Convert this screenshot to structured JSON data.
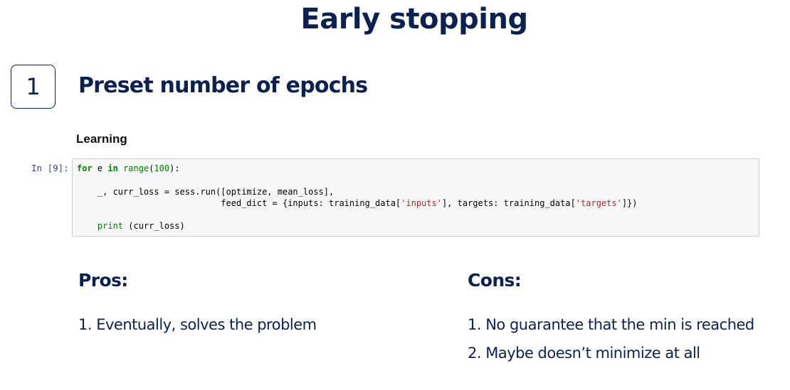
{
  "slide": {
    "title": "Early stopping"
  },
  "section": {
    "number": "1",
    "heading": "Preset number of epochs"
  },
  "notebook": {
    "heading": "Learning",
    "prompt": "In [9]:",
    "code_lines": [
      [
        {
          "text": "for",
          "cls": "kw"
        },
        {
          "text": " e "
        },
        {
          "text": "in",
          "cls": "kw"
        },
        {
          "text": " "
        },
        {
          "text": "range",
          "cls": "bi"
        },
        {
          "text": "("
        },
        {
          "text": "100",
          "cls": "num"
        },
        {
          "text": "):"
        }
      ],
      [],
      [
        {
          "text": "    _, curr_loss = sess.run([optimize, mean_loss],"
        }
      ],
      [
        {
          "text": "                            feed_dict = {inputs: training_data["
        },
        {
          "text": "'inputs'",
          "cls": "str"
        },
        {
          "text": "], targets: training_data["
        },
        {
          "text": "'targets'",
          "cls": "str"
        },
        {
          "text": "]})"
        }
      ],
      [],
      [
        {
          "text": "    "
        },
        {
          "text": "print",
          "cls": "bi"
        },
        {
          "text": " (curr_loss)"
        }
      ]
    ]
  },
  "pros": {
    "heading": "Pros:",
    "items": [
      "1. Eventually, solves the problem"
    ]
  },
  "cons": {
    "heading": "Cons:",
    "items": [
      "1. No guarantee that the min is reached",
      "2. Maybe doesn’t minimize at all"
    ]
  }
}
